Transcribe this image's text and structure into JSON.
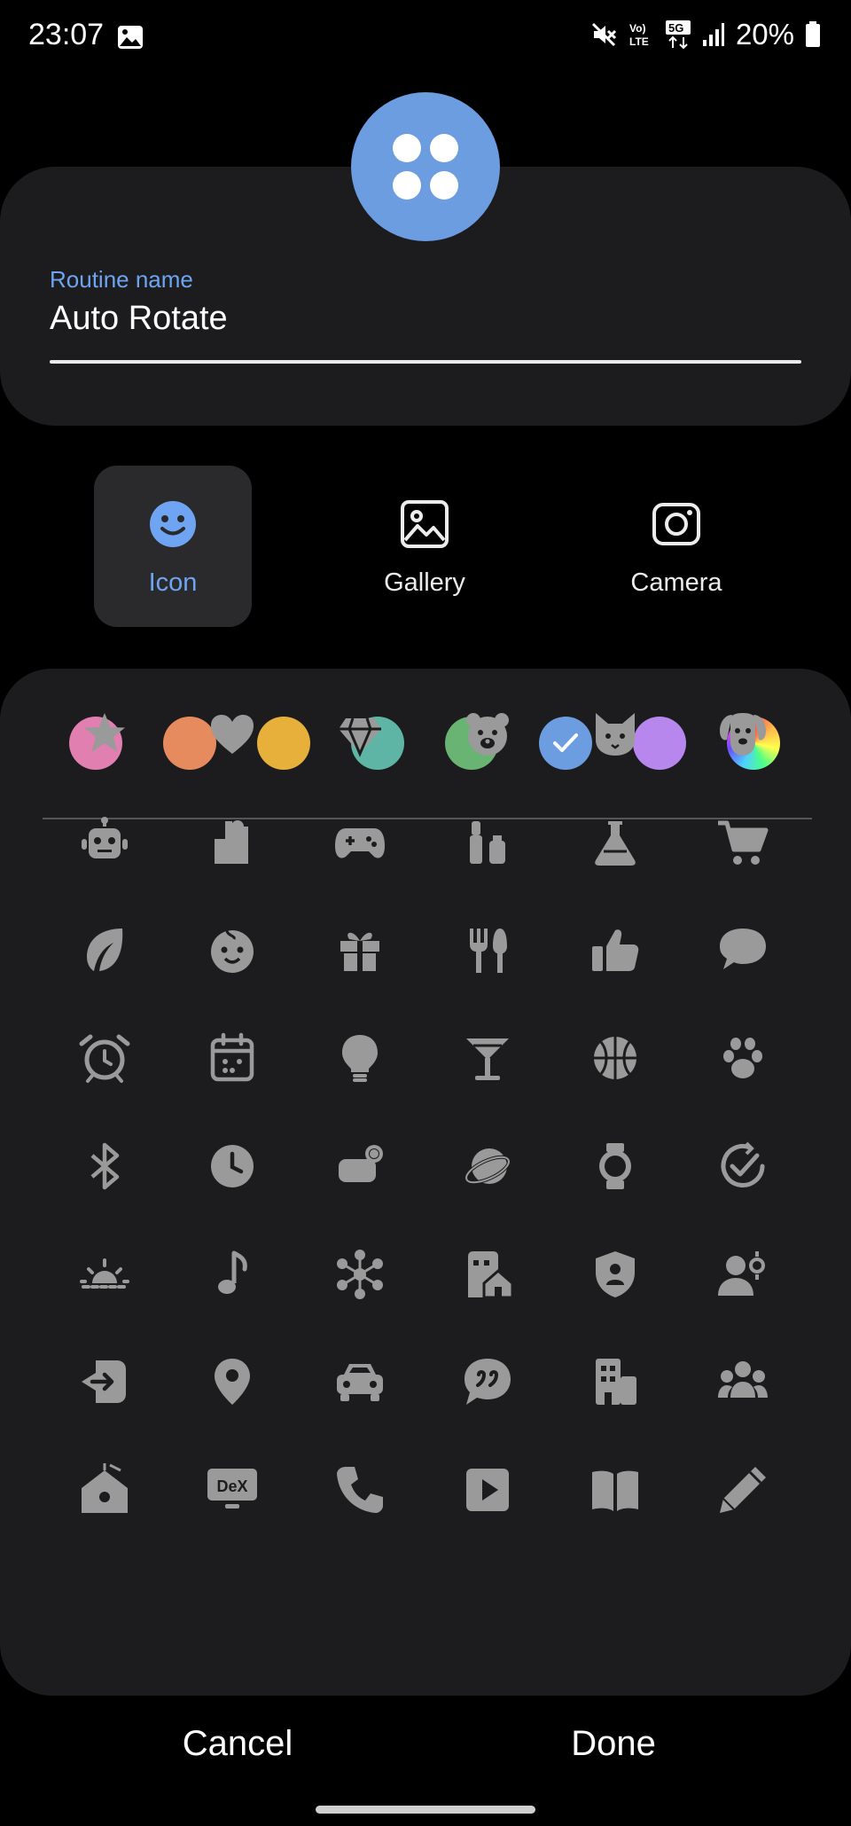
{
  "status_bar": {
    "time": "23:07",
    "battery": "20%",
    "icons": [
      "gallery-notification-icon",
      "mute-icon",
      "volte-icon",
      "5g-icon",
      "signal-icon",
      "battery-icon"
    ]
  },
  "routine": {
    "label": "Routine name",
    "name": "Auto Rotate",
    "icon_color": "#6b9de0"
  },
  "source_tabs": [
    {
      "label": "Icon",
      "selected": true
    },
    {
      "label": "Gallery",
      "selected": false
    },
    {
      "label": "Camera",
      "selected": false
    }
  ],
  "colors": [
    "#e07fb0",
    "#e68b5e",
    "#e6b03a",
    "#5fb5a5",
    "#69b373",
    "#6b9de0",
    "#b887ee",
    "rainbow"
  ],
  "selected_color_index": 5,
  "icons": [
    "star",
    "heart",
    "diamond",
    "bear",
    "cat",
    "dog",
    "robot",
    "puzzle",
    "gamepad",
    "cosmetics",
    "flask",
    "cart",
    "leaf",
    "baby",
    "gift",
    "fork-knife",
    "thumbs-up",
    "chat-bubble",
    "alarm",
    "calendar",
    "lightbulb",
    "cocktail",
    "basketball",
    "paw",
    "bluetooth",
    "clock",
    "toggle",
    "planet",
    "watch",
    "task-check",
    "sunrise",
    "music-note",
    "network",
    "home-building",
    "shield-person",
    "person-settings",
    "exit-arrow",
    "location-pin",
    "car",
    "quote-bubble",
    "office-building",
    "group",
    "home-bell",
    "dex",
    "phone",
    "play",
    "book",
    "pencil"
  ],
  "footer": {
    "cancel": "Cancel",
    "done": "Done"
  }
}
